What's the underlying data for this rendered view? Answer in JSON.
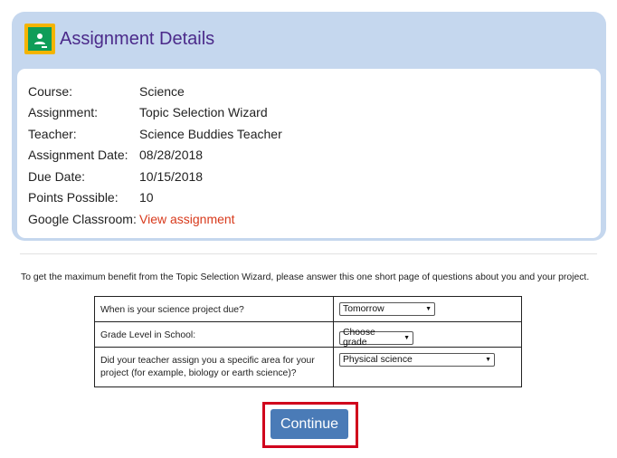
{
  "card": {
    "title": "Assignment Details",
    "logo_icon": "google-classroom-icon",
    "details": [
      {
        "label": "Course:",
        "value": "Science"
      },
      {
        "label": "Assignment:",
        "value": "Topic Selection Wizard"
      },
      {
        "label": "Teacher:",
        "value": "Science Buddies Teacher"
      },
      {
        "label": "Assignment Date:",
        "value": "08/28/2018"
      },
      {
        "label": "Due Date:",
        "value": "10/15/2018"
      },
      {
        "label": "Points Possible:",
        "value": "10"
      },
      {
        "label": "Google Classroom:",
        "link": "View assignment"
      }
    ]
  },
  "intro": "To get the maximum benefit from the Topic Selection Wizard, please answer this one short page of questions about you and your project.",
  "questions": [
    {
      "question": "When is your science project due?",
      "selected": "Tomorrow"
    },
    {
      "question": "Grade Level in School:",
      "selected": "Choose grade"
    },
    {
      "question": "Did your teacher assign you a specific area for your project (for example, biology or earth science)?",
      "selected": "Physical science"
    }
  ],
  "continue_label": "Continue",
  "colors": {
    "card_bg": "#c5d7ee",
    "title": "#4b2a8a",
    "link": "#d83a1c",
    "button": "#4a7bb7",
    "highlight": "#d0001c"
  }
}
